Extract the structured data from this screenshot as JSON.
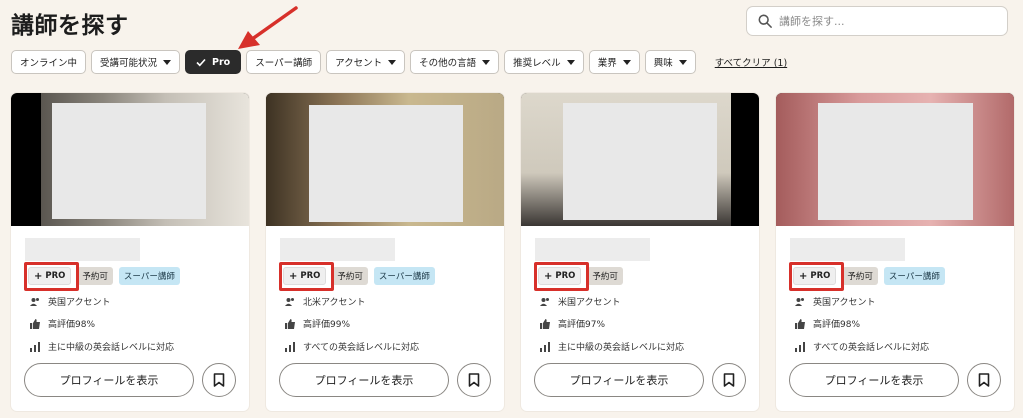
{
  "page": {
    "title": "講師を探す"
  },
  "search": {
    "placeholder": "講師を探す..."
  },
  "filters": [
    {
      "label": "オンライン中",
      "dropdown": false,
      "active": false
    },
    {
      "label": "受講可能状況",
      "dropdown": true,
      "active": false
    },
    {
      "label": "Pro",
      "dropdown": false,
      "active": true
    },
    {
      "label": "スーパー講師",
      "dropdown": false,
      "active": false
    },
    {
      "label": "アクセント",
      "dropdown": true,
      "active": false
    },
    {
      "label": "その他の言語",
      "dropdown": true,
      "active": false
    },
    {
      "label": "推奨レベル",
      "dropdown": true,
      "active": false
    },
    {
      "label": "業界",
      "dropdown": true,
      "active": false
    },
    {
      "label": "興味",
      "dropdown": true,
      "active": false
    }
  ],
  "clear_all": "すべてクリア (1)",
  "colors": {
    "accent": "#d7302a",
    "active_chip": "#2b2b2b",
    "super_badge": "#c5e6f4",
    "background": "#f8f3ec"
  },
  "cards": [
    {
      "badges": {
        "pro": "PRO",
        "book": "予約可",
        "super": "スーパー講師"
      },
      "accent": "英国アクセント",
      "rating": "高評価98%",
      "level": "主に中級の英会話レベルに対応",
      "profile_button": "プロフィールを表示"
    },
    {
      "badges": {
        "pro": "PRO",
        "book": "予約可",
        "super": "スーパー講師"
      },
      "accent": "北米アクセント",
      "rating": "高評価99%",
      "level": "すべての英会話レベルに対応",
      "profile_button": "プロフィールを表示"
    },
    {
      "badges": {
        "pro": "PRO",
        "book": "予約可",
        "super": ""
      },
      "accent": "米国アクセント",
      "rating": "高評価97%",
      "level": "主に中級の英会話レベルに対応",
      "profile_button": "プロフィールを表示"
    },
    {
      "badges": {
        "pro": "PRO",
        "book": "予約可",
        "super": "スーパー講師"
      },
      "accent": "英国アクセント",
      "rating": "高評価98%",
      "level": "すべての英会話レベルに対応",
      "profile_button": "プロフィールを表示"
    }
  ]
}
